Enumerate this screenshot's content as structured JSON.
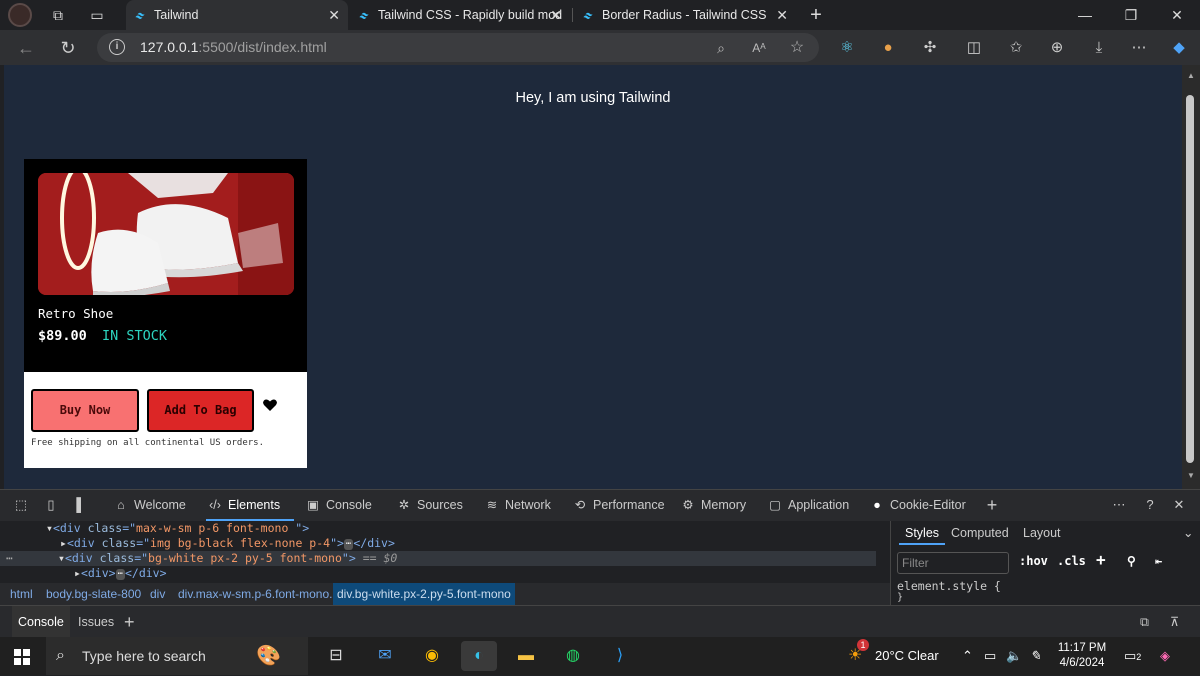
{
  "browser": {
    "tabs": [
      {
        "label": "Tailwind",
        "active": true
      },
      {
        "label": "Tailwind CSS - Rapidly build mod",
        "active": false
      },
      {
        "label": "Border Radius - Tailwind CSS",
        "active": false
      }
    ],
    "url_host": "127.0.0.1",
    "url_rest": ":5500/dist/index.html",
    "new_tab": "+",
    "reader_label": "Aᴬ"
  },
  "page": {
    "headline": "Hey, I am using Tailwind",
    "product": {
      "name": "Retro Shoe",
      "price": "$89.00",
      "stock": "IN STOCK",
      "buy_label": "Buy Now",
      "bag_label": "Add To Bag",
      "shipping": "Free shipping on all continental US orders."
    }
  },
  "devtools": {
    "tabs": [
      {
        "label": "Welcome",
        "icon": "home-icon"
      },
      {
        "label": "Elements",
        "icon": "code-icon"
      },
      {
        "label": "Console",
        "icon": "console-icon"
      },
      {
        "label": "Sources",
        "icon": "bug-icon"
      },
      {
        "label": "Network",
        "icon": "wifi-icon"
      },
      {
        "label": "Performance",
        "icon": "performance-icon"
      },
      {
        "label": "Memory",
        "icon": "chip-icon"
      },
      {
        "label": "Application",
        "icon": "window-icon"
      },
      {
        "label": "Cookie-Editor",
        "icon": "cookie-icon"
      }
    ],
    "dom_lines": [
      {
        "tag": "div",
        "attr": "class",
        "value": "max-w-sm p-6 font-mono ",
        "suffix": ""
      },
      {
        "tag": "div",
        "attr": "class",
        "value": "img  bg-black flex-none p-4",
        "suffix": "</div>"
      },
      {
        "tag": "div",
        "attr": "class",
        "value": "bg-white px-2 py-5  font-mono",
        "suffix": "== $0"
      },
      {
        "tag": "div",
        "attr": "",
        "value": "",
        "suffix": "</div>"
      }
    ],
    "breadcrumbs": [
      "html",
      "body.bg-slate-800",
      "div",
      "div.max-w-sm.p-6.font-mono.",
      "div.bg-white.px-2.py-5.font-mono"
    ],
    "styles_tabs": [
      "Styles",
      "Computed",
      "Layout"
    ],
    "filter_placeholder": "Filter",
    "hov": ":hov",
    "cls": ".cls",
    "element_style": "element.style {",
    "element_style_close": "}",
    "drawer_tabs": [
      "Console",
      "Issues"
    ],
    "add": "+"
  },
  "taskbar": {
    "search_placeholder": "Type here to search",
    "weather": "20°C  Clear",
    "time": "11:17 PM",
    "date": "4/6/2024",
    "notifications": "2",
    "weather_badge": "1"
  }
}
